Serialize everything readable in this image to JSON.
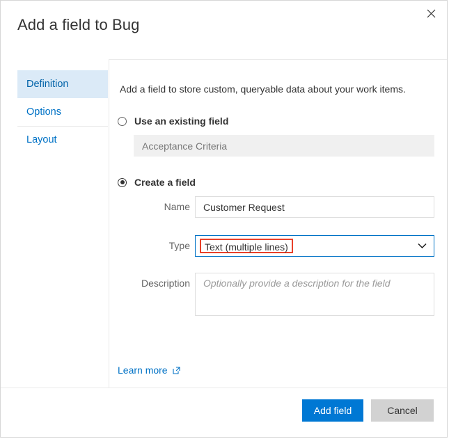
{
  "dialog": {
    "title": "Add a field to Bug",
    "close_icon": "close-icon"
  },
  "pivot": {
    "items": [
      {
        "label": "Definition",
        "selected": true
      },
      {
        "label": "Options",
        "selected": false
      },
      {
        "label": "Layout",
        "selected": false
      }
    ]
  },
  "content": {
    "intro": "Add a field to store custom, queryable data about your work items.",
    "existing": {
      "radio_label": "Use an existing field",
      "selected": false,
      "field_value": "Acceptance Criteria"
    },
    "create": {
      "radio_label": "Create a field",
      "selected": true,
      "name": {
        "label": "Name",
        "value": "Customer Request"
      },
      "type": {
        "label": "Type",
        "value": "Text (multiple lines)",
        "chevron_icon": "chevron-down-icon",
        "highlight_color": "#e8402a",
        "focus_color": "#0072c6"
      },
      "description": {
        "label": "Description",
        "value": "",
        "placeholder": "Optionally provide a description for the field"
      }
    },
    "learn_more": {
      "label": "Learn more",
      "icon": "external-link-icon"
    }
  },
  "footer": {
    "primary_label": "Add field",
    "secondary_label": "Cancel",
    "primary_color": "#0078d4"
  }
}
